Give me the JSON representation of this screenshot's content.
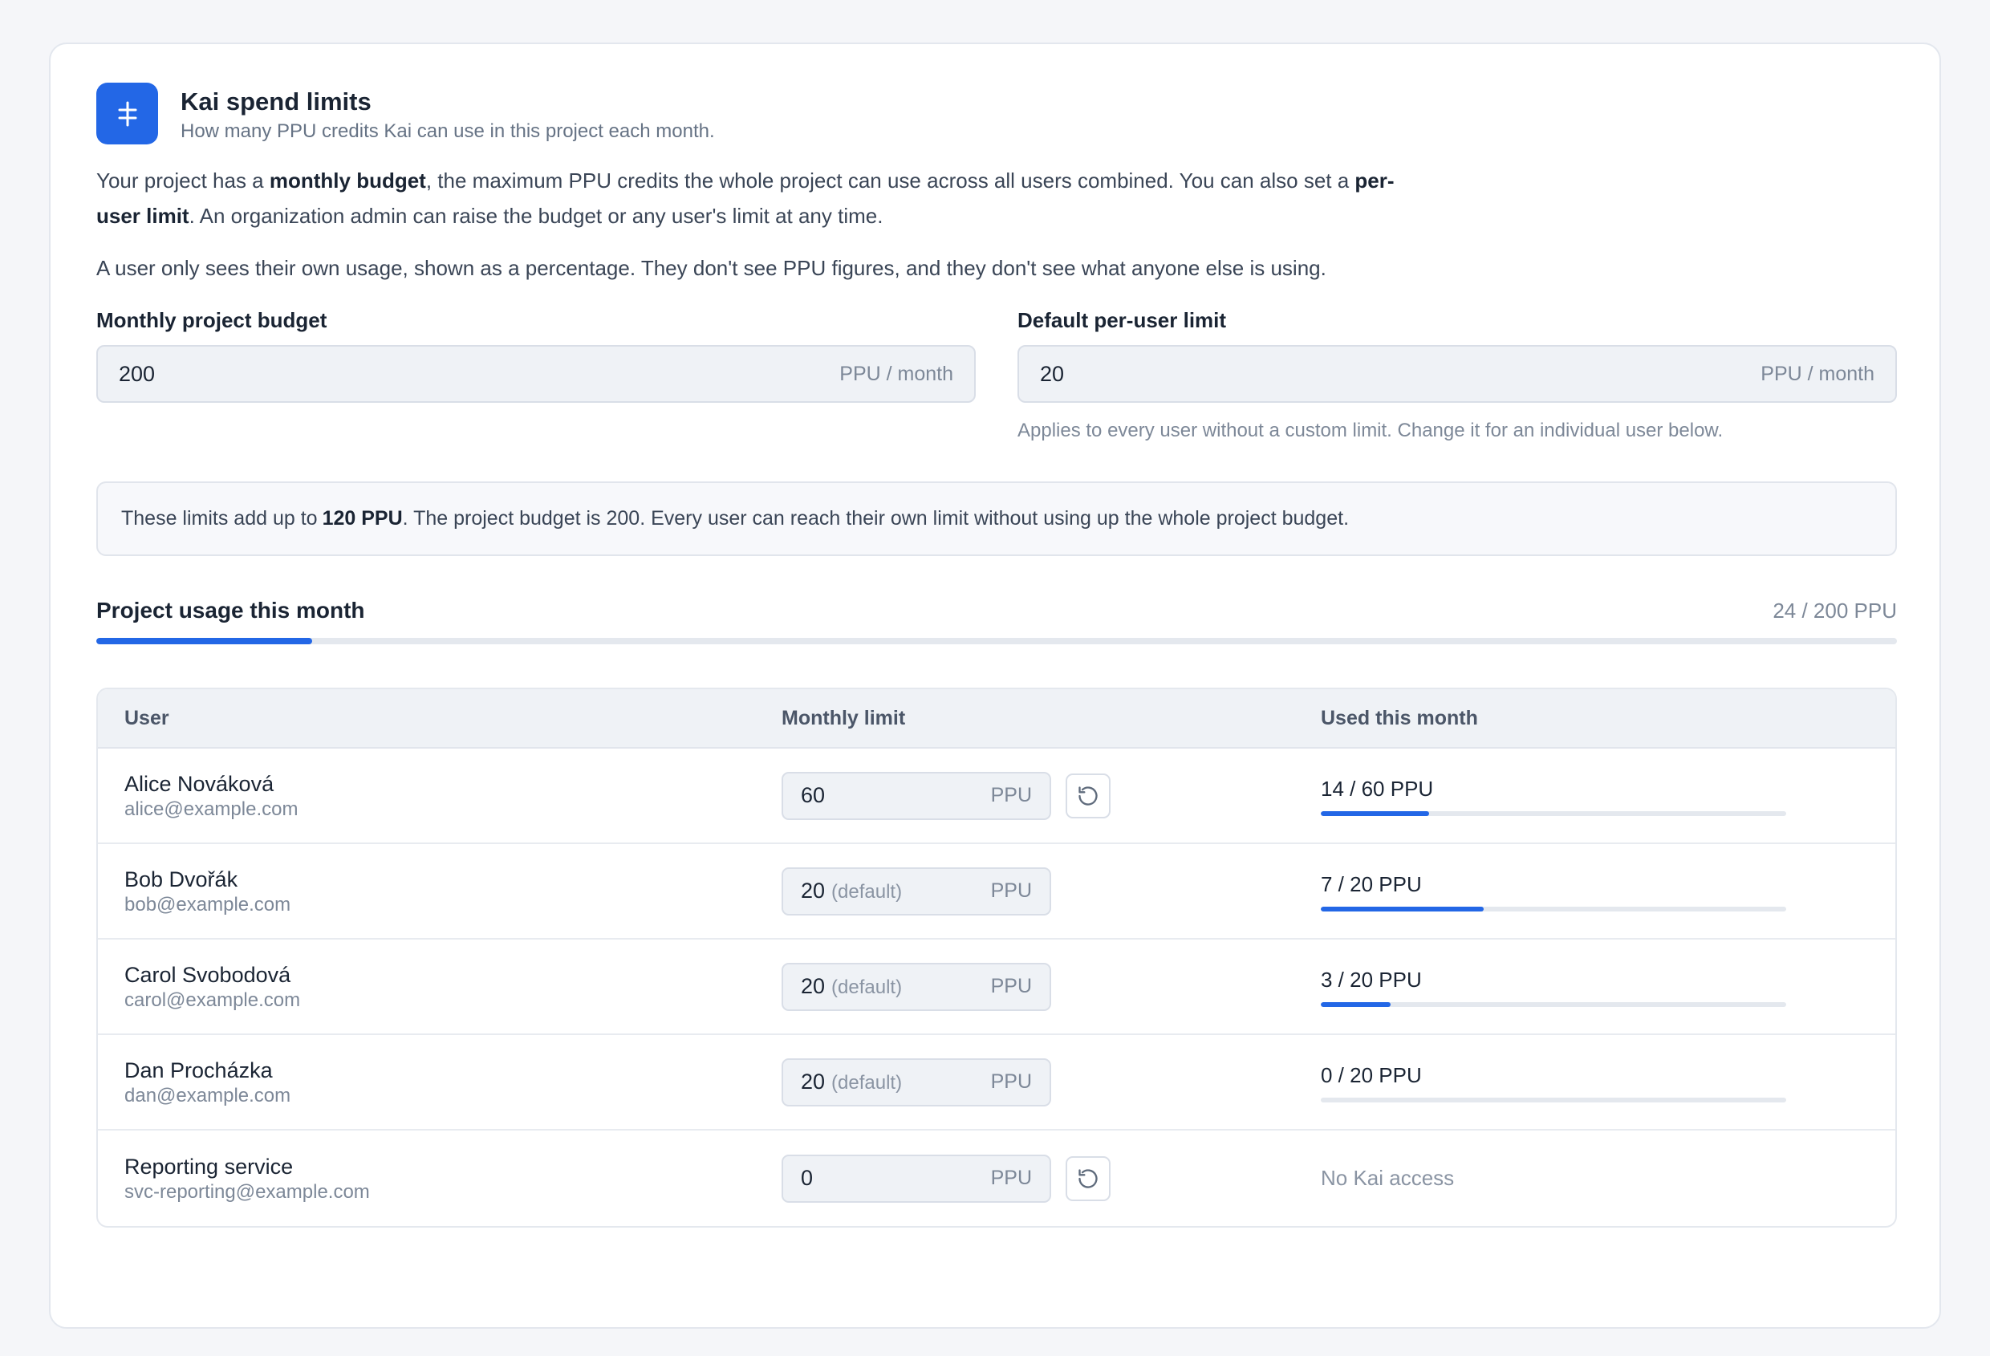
{
  "colors": {
    "accent": "#2367e6",
    "track": "#e4e8ee"
  },
  "header": {
    "title": "Kai spend limits",
    "subtitle": "How many PPU credits Kai can use in this project each month.",
    "icon": "kai-logo-icon"
  },
  "intro": {
    "p1_a": "Your project has a ",
    "p1_b": "monthly budget",
    "p1_c": ", the maximum PPU credits the whole project can use across all users combined. You can also set a ",
    "p1_d": "per-user limit",
    "p1_e": ". An organization admin can raise the budget or any user's limit at any time.",
    "p2": "A user only sees their own usage, shown as a percentage. They don't see PPU figures, and they don't see what anyone else is using."
  },
  "budget": {
    "label": "Monthly project budget",
    "value": "200",
    "unit": "PPU / month"
  },
  "default_limit": {
    "label": "Default per-user limit",
    "value": "20",
    "unit": "PPU / month",
    "hint": "Applies to every user without a custom limit. Change it for an individual user below."
  },
  "notice": {
    "a": "These limits add up to",
    "b": "120 PPU",
    "c": ". The project budget is 200. Every user can reach their own limit without using up the whole project budget."
  },
  "usage": {
    "title": "Project usage this month",
    "value": "24 / 200 PPU",
    "fraction": 0.12
  },
  "table": {
    "headers": {
      "user": "User",
      "limit": "Monthly limit",
      "used": "Used this month"
    },
    "rows": [
      {
        "name": "Alice Nováková",
        "email": "alice@example.com",
        "limit": "60",
        "default": "",
        "unit": "PPU",
        "reset": true,
        "used": "14 / 60 PPU",
        "fraction": 0.2333,
        "access": true
      },
      {
        "name": "Bob Dvořák",
        "email": "bob@example.com",
        "limit": "20",
        "default": "(default)",
        "unit": "PPU",
        "reset": false,
        "used": "7 / 20 PPU",
        "fraction": 0.35,
        "access": true
      },
      {
        "name": "Carol Svobodová",
        "email": "carol@example.com",
        "limit": "20",
        "default": "(default)",
        "unit": "PPU",
        "reset": false,
        "used": "3 / 20 PPU",
        "fraction": 0.15,
        "access": true
      },
      {
        "name": "Dan Procházka",
        "email": "dan@example.com",
        "limit": "20",
        "default": "(default)",
        "unit": "PPU",
        "reset": false,
        "used": "0 / 20 PPU",
        "fraction": 0,
        "access": true
      },
      {
        "name": "Reporting service",
        "email": "svc-reporting@example.com",
        "limit": "0",
        "default": "",
        "unit": "PPU",
        "reset": true,
        "used": "",
        "no_access_label": "No Kai access",
        "access": false
      }
    ]
  }
}
